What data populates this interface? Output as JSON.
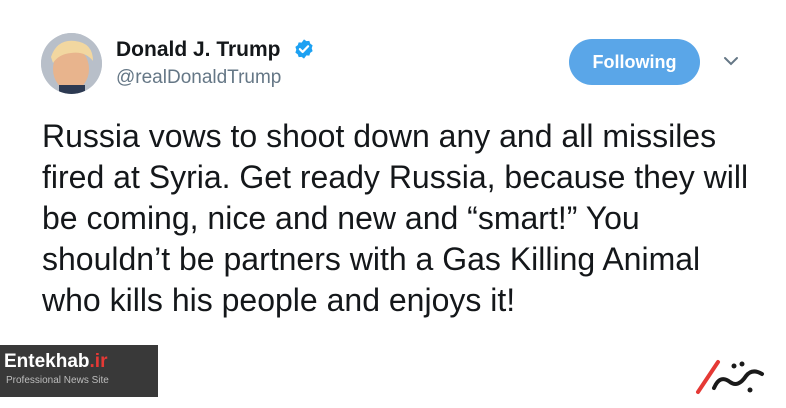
{
  "author": {
    "name": "Donald J. Trump",
    "handle": "@realDonaldTrump",
    "avatar_icon": "profile-photo",
    "verified_icon": "verified-badge-icon"
  },
  "actions": {
    "follow_label": "Following",
    "menu_icon": "chevron-down-icon"
  },
  "tweet": {
    "text": "Russia vows to shoot down any and all missiles fired at Syria. Get ready Russia, because they will be coming, nice and new and “smart!” You shouldn’t be partners with a Gas Killing Animal who kills his people and enjoys it!"
  },
  "watermarks": {
    "left_main": "Entekhab",
    "left_suffix": ".ir",
    "left_sub": "Professional News Site",
    "right_logo": "entekhab-logo"
  },
  "colors": {
    "accent": "#5aa6e8",
    "text": "#14171a",
    "secondary": "#657786",
    "watermark_red": "#e53935"
  }
}
